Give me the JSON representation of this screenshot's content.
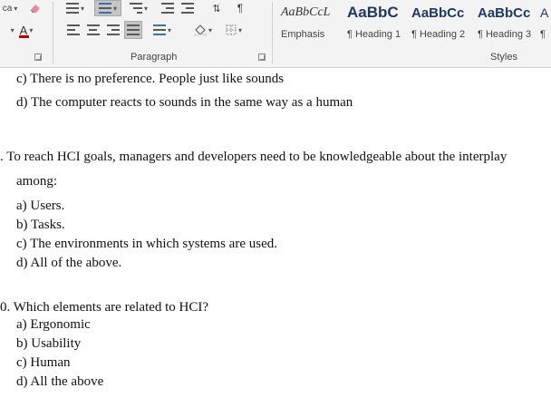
{
  "ribbon": {
    "font_size_fragment": "ca",
    "clear_format_icon": "eraser-icon",
    "font_color_icon": "font-color-icon",
    "font_color_letter": "A",
    "font_color_accent": "#c00000",
    "paragraph_label": "Paragraph",
    "styles_label": "Styles",
    "styles": [
      {
        "sample": "AaBbCcL",
        "name": "Emphasis"
      },
      {
        "sample": "AaBbC",
        "name": "¶ Heading 1"
      },
      {
        "sample": "AaBbCc",
        "name": "¶ Heading 2"
      },
      {
        "sample": "AaBbCc",
        "name": "¶ Heading 3"
      },
      {
        "sample": "A",
        "name": "¶"
      }
    ]
  },
  "document": {
    "q8_c": "c)  There is no preference. People just like sounds",
    "q8_d": "d)  The computer reacts to sounds in the same way as a human",
    "q9_prompt_1": ".  To reach HCI goals, managers and developers need to be knowledgeable about the interplay",
    "q9_prompt_2": "among:",
    "q9_a": "a)  Users.",
    "q9_b": "b)  Tasks.",
    "q9_c": "c)  The environments in which systems are used.",
    "q9_d": "d)  All of the above.",
    "q10_prompt": "0. Which elements are related to HCI?",
    "q10_a": "a)  Ergonomic",
    "q10_b": "b)  Usability",
    "q10_c": "c)  Human",
    "q10_d": "d)  All the above"
  }
}
